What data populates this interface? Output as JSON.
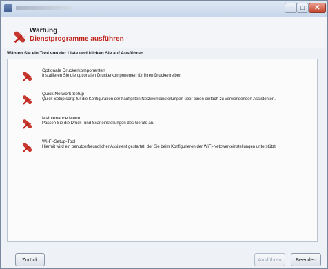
{
  "window": {
    "title": ""
  },
  "header": {
    "title": "Wartung",
    "subtitle": "Dienstprogramme ausführen"
  },
  "instruction": "Wählen Sie ein Tool von der Liste und klicken Sie auf Ausführen.",
  "tools": [
    {
      "title": "Optionale Druckerkomponenten",
      "description": "Installieren Sie die optionalen Druckerkomponenten für Ihren Druckertreiber.",
      "icon": "tools-icon"
    },
    {
      "title": "Quick Network Setup",
      "description": "Quick Setup sorgt für die Konfiguration der häufigsten Netzwerkeinstellungen über einen einfach zu verwendenden Assistenten.",
      "icon": "tools-icon"
    },
    {
      "title": "Maintenance Menu",
      "description": "Passen Sie die Druck- und Scaneinstellungen des Geräts an.",
      "icon": "tools-icon"
    },
    {
      "title": "Wi-Fi-Setup-Tool",
      "description": "Hiermit wird ein benutzerfreundlicher Assistent gestartet, der Sie beim Konfigurieren der WiFi-Netzwerkeinstellungen unterstützt.",
      "icon": "tools-icon"
    }
  ],
  "buttons": {
    "back": "Zurück",
    "run": "Ausführen",
    "exit": "Beenden"
  },
  "colors": {
    "accent_red": "#c0241a"
  }
}
